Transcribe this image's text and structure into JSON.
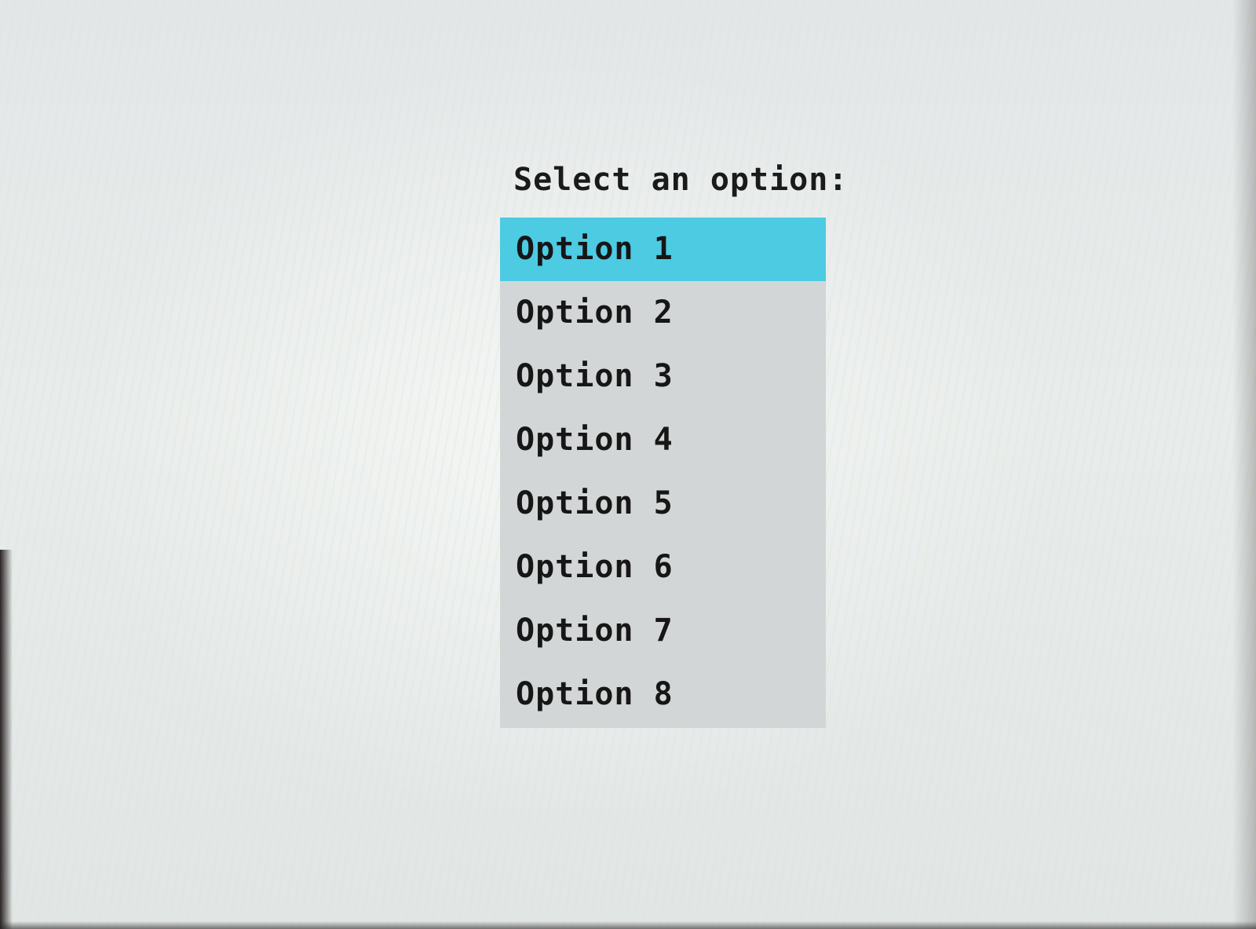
{
  "prompt": {
    "label": "Select an option:"
  },
  "options": {
    "items": [
      {
        "label": "Option 1",
        "selected": true
      },
      {
        "label": "Option 2",
        "selected": false
      },
      {
        "label": "Option 3",
        "selected": false
      },
      {
        "label": "Option 4",
        "selected": false
      },
      {
        "label": "Option 5",
        "selected": false
      },
      {
        "label": "Option 6",
        "selected": false
      },
      {
        "label": "Option 7",
        "selected": false
      },
      {
        "label": "Option 8",
        "selected": false
      }
    ],
    "selected_color": "#4ccbe3",
    "list_background": "#d3d6d6"
  }
}
